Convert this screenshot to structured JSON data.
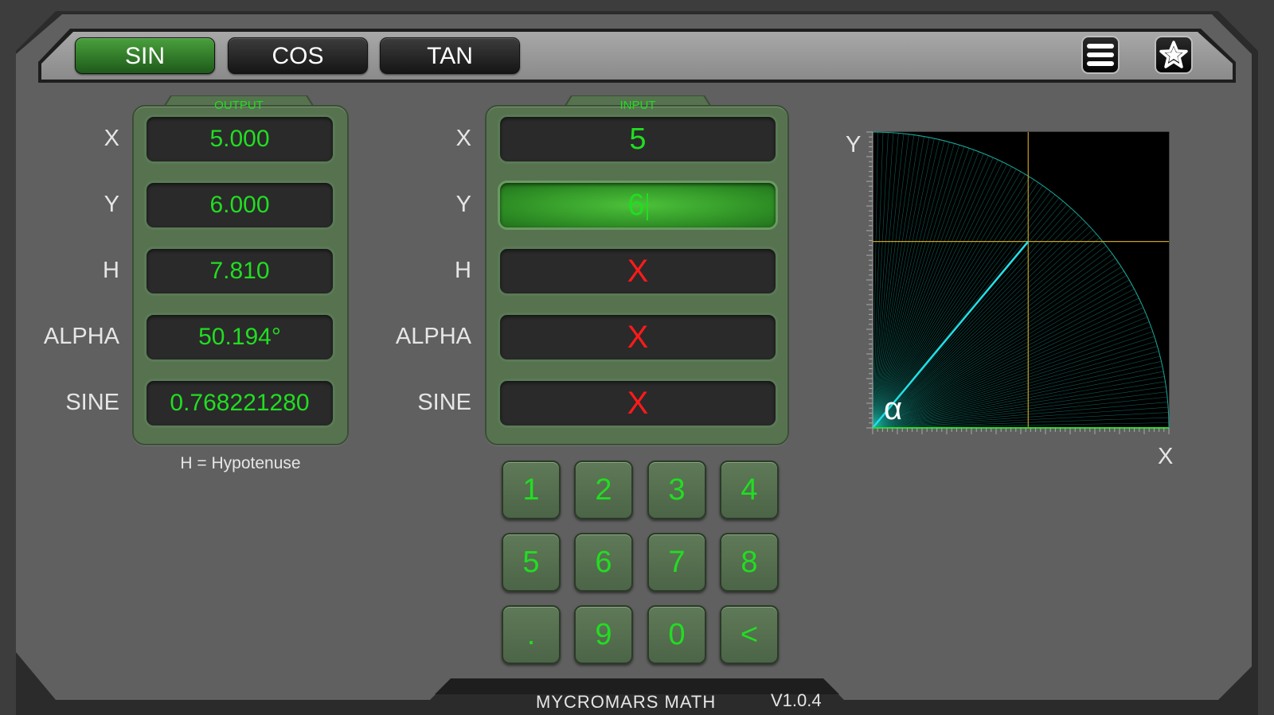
{
  "tabs": [
    {
      "label": "SIN",
      "active": true
    },
    {
      "label": "COS",
      "active": false
    },
    {
      "label": "TAN",
      "active": false
    }
  ],
  "toolbar": {
    "menu_icon": "menu-icon",
    "favorite_icon": "star-icon"
  },
  "output": {
    "title": "OUTPUT",
    "rows": [
      {
        "label": "X",
        "value": "5.000"
      },
      {
        "label": "Y",
        "value": "6.000"
      },
      {
        "label": "H",
        "value": "7.810"
      },
      {
        "label": "ALPHA",
        "value": "50.194°"
      },
      {
        "label": "SINE",
        "value": "0.768221280"
      }
    ],
    "note": "H = Hypotenuse"
  },
  "input": {
    "title": "INPUT",
    "rows": [
      {
        "label": "X",
        "value": "5"
      },
      {
        "label": "Y",
        "value": "6"
      },
      {
        "label": "H",
        "value": "X"
      },
      {
        "label": "ALPHA",
        "value": "X"
      },
      {
        "label": "SINE",
        "value": "X"
      }
    ]
  },
  "keypad": [
    "1",
    "2",
    "3",
    "4",
    "5",
    "6",
    "7",
    "8",
    ".",
    "9",
    "0",
    "<"
  ],
  "graph": {
    "y_axis_label": "Y",
    "x_axis_label": "X",
    "angle_symbol": "α",
    "point": {
      "x": 5,
      "y": 6
    }
  },
  "footer": {
    "app_name": "MYCROMARS MATH",
    "version": "V1.0.4"
  },
  "colors": {
    "accent_green": "#22dd22",
    "invalid_red": "#ff1a1a",
    "active_tab": "#2f7a28"
  }
}
